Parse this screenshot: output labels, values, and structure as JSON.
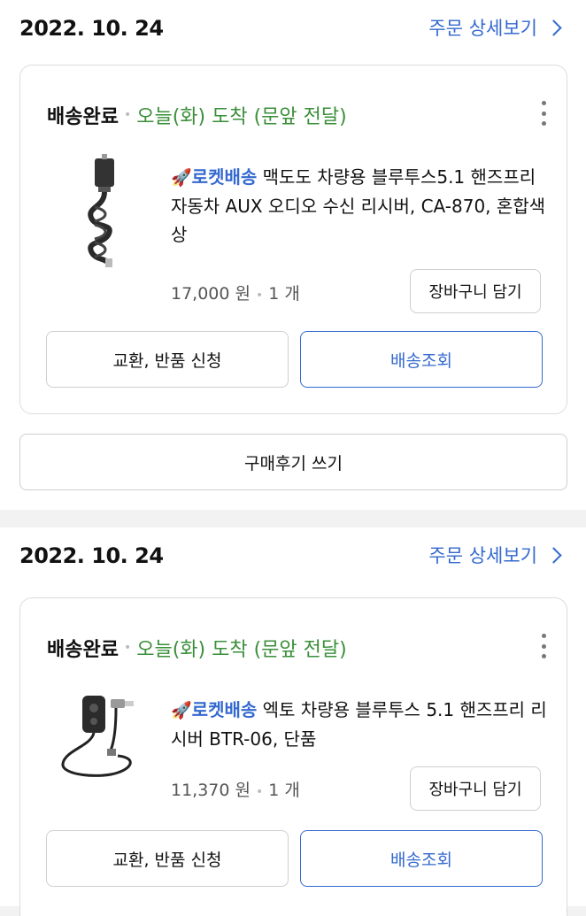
{
  "orders": [
    {
      "date": "2022. 10. 24",
      "detail_link": "주문 상세보기",
      "status": "배송완료",
      "arrival": "오늘(화) 도착 (문앞 전달)",
      "rocket_label": "로켓배송",
      "product_name": "맥도도 차량용 블루투스5.1 핸즈프리 자동차 AUX 오디오 수신 리시버, CA-870, 혼합색상",
      "price": "17,000 원",
      "quantity": "1 개",
      "cart_label": "장바구니 담기",
      "return_label": "교환, 반품 신청",
      "track_label": "배송조회",
      "review_label": "구매후기 쓰기",
      "thumb_icon": "coiled-aux-cable-receiver"
    },
    {
      "date": "2022. 10. 24",
      "detail_link": "주문 상세보기",
      "status": "배송완료",
      "arrival": "오늘(화) 도착 (문앞 전달)",
      "rocket_label": "로켓배송",
      "product_name": "엑토 차량용 블루투스 5.1 핸즈프리 리시버 BTR-06, 단품",
      "price": "11,370 원",
      "quantity": "1 개",
      "cart_label": "장바구니 담기",
      "return_label": "교환, 반품 신청",
      "track_label": "배송조회",
      "thumb_icon": "bluetooth-receiver-with-cables"
    }
  ],
  "colors": {
    "accent_blue": "#3469cf",
    "arrival_green": "#3a8f3a",
    "border": "#dcdcdc",
    "page_bg": "#f2f2f2"
  }
}
